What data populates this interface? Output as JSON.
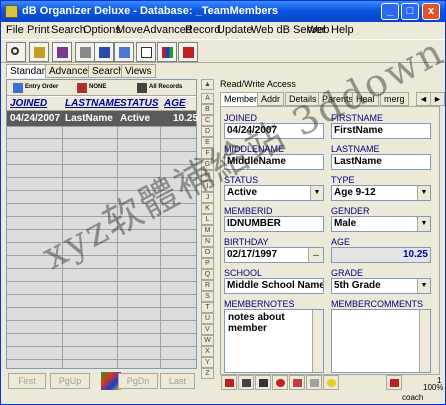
{
  "window": {
    "title": "dB Organizer Deluxe - Database: _TeamMembers",
    "minimize": "_",
    "maximize": "□",
    "close": "x"
  },
  "menu": [
    "File",
    "Print",
    "Search",
    "Options",
    "Move",
    "Advanced",
    "Record",
    "Update",
    "Web dB Server",
    "Web",
    "Help"
  ],
  "view_tabs": [
    "Standard",
    "Advanced",
    "Search",
    "Views"
  ],
  "sort_buttons": [
    "Entry Order",
    "NONE",
    "All Records"
  ],
  "grid": {
    "columns": [
      "JOINED",
      "LASTNAME",
      "STATUS",
      "AGE"
    ],
    "rows": [
      {
        "joined": "04/24/2007",
        "lastname": "LastName",
        "status": "Active",
        "age": "10.25"
      }
    ]
  },
  "nav_buttons": {
    "first": "First",
    "pgup": "PgUp",
    "pgdn": "PgDn",
    "last": "Last"
  },
  "alpha_index": [
    "A",
    "B",
    "C",
    "D",
    "E",
    "F",
    "G",
    "H",
    "I",
    "J",
    "K",
    "L",
    "M",
    "N",
    "O",
    "P",
    "Q",
    "R",
    "S",
    "T",
    "U",
    "V",
    "W",
    "X",
    "Y",
    "Z"
  ],
  "form": {
    "readwrite": "Read/Write Access",
    "tabs": [
      "Member",
      "Addr",
      "Details",
      "Parents",
      "Heal",
      "merg"
    ],
    "fields": {
      "joined_label": "JOINED",
      "joined": "04/24/2007",
      "firstname_label": "FIRSTNAME",
      "firstname": "FirstName",
      "middlename_label": "MIDDLENAME",
      "middlename": "MiddleName",
      "lastname_label": "LASTNAME",
      "lastname": "LastName",
      "status_label": "STATUS",
      "status": "Active",
      "type_label": "TYPE",
      "type": "Age 9-12",
      "memberid_label": "MEMBERID",
      "memberid": "IDNUMBER",
      "gender_label": "GENDER",
      "gender": "Male",
      "birthday_label": "BIRTHDAY",
      "birthday": "02/17/1997",
      "birthday_btn": "...",
      "age_label": "AGE",
      "age": "10.25",
      "school_label": "SCHOOL",
      "school": "Middle School Name",
      "grade_label": "GRADE",
      "grade": "5th Grade",
      "membernotes_label": "MEMBERNOTES",
      "membernotes": "notes about member",
      "membercomments_label": "MEMBERCOMMENTS",
      "membercomments": ""
    }
  },
  "status": {
    "count": "1",
    "zoom": "100%",
    "user": "coach"
  },
  "watermark": "xyz软體補給站 3ddown.com",
  "colors": {
    "titlebar": "#0a56e0",
    "label": "#000080",
    "selected_row": "#5a5a5a",
    "age_value": "#0000c0"
  },
  "icons": [
    "search-icon",
    "open-icon",
    "edit-icon",
    "print-icon",
    "table-icon",
    "form-icon",
    "page-icon",
    "chart-icon",
    "exit-icon"
  ]
}
